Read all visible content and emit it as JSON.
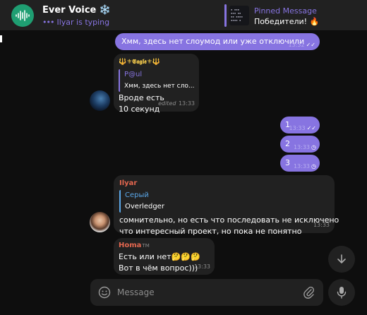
{
  "header": {
    "chat_title": "Ever Voice",
    "chat_title_emoji": "❄️",
    "status_dots": "•••",
    "status": "Ilyar is typing",
    "pinned_label": "Pinned Message",
    "pinned_text": "Победители! 🔥"
  },
  "messages": [
    {
      "kind": "outgoing",
      "text": "Хмм, здесь нет слоумод или уже отключили",
      "time": "13:32",
      "status": "read"
    },
    {
      "kind": "incoming",
      "sender": "🔱⚜𝕰𝖆𝖌𝖑𝖊⚜🔱",
      "reply_name": "P@ul",
      "reply_text": "Хмм, здесь нет сло...",
      "lines": [
        "Вроде есть",
        "10 секунд"
      ],
      "edited": "edited",
      "time": "13:33"
    },
    {
      "kind": "outgoing",
      "text": "1",
      "time": "13:33",
      "status": "read"
    },
    {
      "kind": "outgoing",
      "text": "2",
      "time": "13:33",
      "status": "pending"
    },
    {
      "kind": "outgoing",
      "text": "3",
      "time": "13:33",
      "status": "pending"
    },
    {
      "kind": "incoming",
      "sender": "Ilyar",
      "reply_name": "Серый",
      "reply_text": "Overledger",
      "lines": [
        "сомнительно, но есть что последовать не исключено",
        "что интересный проект, но пока не понятно"
      ],
      "time": "13:33"
    },
    {
      "kind": "incoming",
      "sender": "Homa",
      "sender_badge": "TM",
      "lines": [
        "Есть или нет🤔🤔🤔",
        "Вот в чём вопрос)))"
      ],
      "time": "13:33"
    }
  ],
  "composer": {
    "placeholder": "Message"
  },
  "colors": {
    "accent": "#8774e1",
    "bubble_in": "#212121",
    "background": "#0e0e0e",
    "eagle_name": "#f2c94c",
    "ilyar_name": "#e5674f",
    "homa_name": "#e5674f",
    "reply_name_seryi": "#5aa7e8"
  },
  "icons": [
    "sound-wave-icon",
    "read-checks-icon",
    "clock-icon",
    "scroll-down-icon",
    "emoji-icon",
    "attach-icon",
    "microphone-icon"
  ]
}
